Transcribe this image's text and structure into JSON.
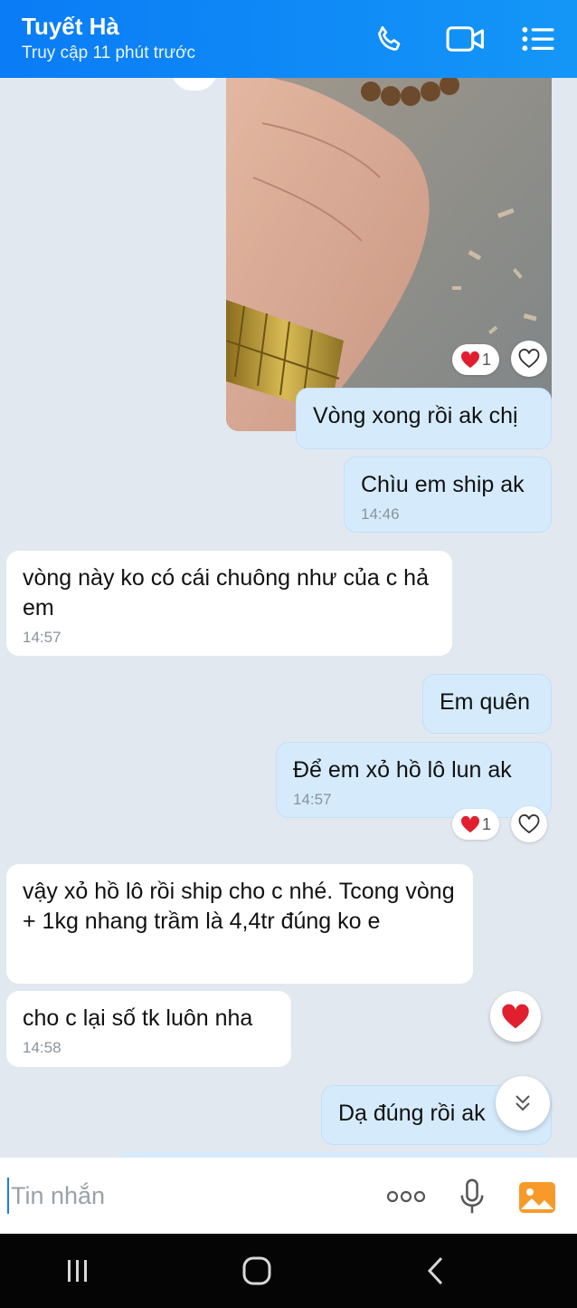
{
  "header": {
    "contact_name": "Tuyết Hà",
    "status": "Truy cập 11 phút trước"
  },
  "messages": [
    {
      "dir": "out",
      "text": "Vòng xong rồi ak chị",
      "time": ""
    },
    {
      "dir": "out",
      "text": "Chìu em ship ak",
      "time": "14:46"
    },
    {
      "dir": "in",
      "text": "vòng này ko có cái chuông như của c hả em",
      "time": "14:57"
    },
    {
      "dir": "out",
      "text": "Em quên",
      "time": ""
    },
    {
      "dir": "out",
      "text": "Để  em xỏ hồ lô lun ak",
      "time": "14:57"
    },
    {
      "dir": "in",
      "text": "vậy xỏ hồ lô rồi ship cho c nhé. Tcong vòng + 1kg nhang trầm là 4,4tr đúng ko e",
      "time": ""
    },
    {
      "dir": "in",
      "text": "cho c lại số tk luôn nha",
      "time": "14:58"
    },
    {
      "dir": "out",
      "text": "Dạ đúng rồi ak",
      "time": ""
    }
  ],
  "reactions": {
    "photo_count": "1",
    "msg5_count": "1"
  },
  "input": {
    "placeholder": "Tin nhắn"
  },
  "colors": {
    "header": "#0a7cf6",
    "outgoing_bubble": "#d5ebfc",
    "incoming_bubble": "#ffffff",
    "chat_background": "#e2e8ef",
    "heart": "#e0202e"
  }
}
